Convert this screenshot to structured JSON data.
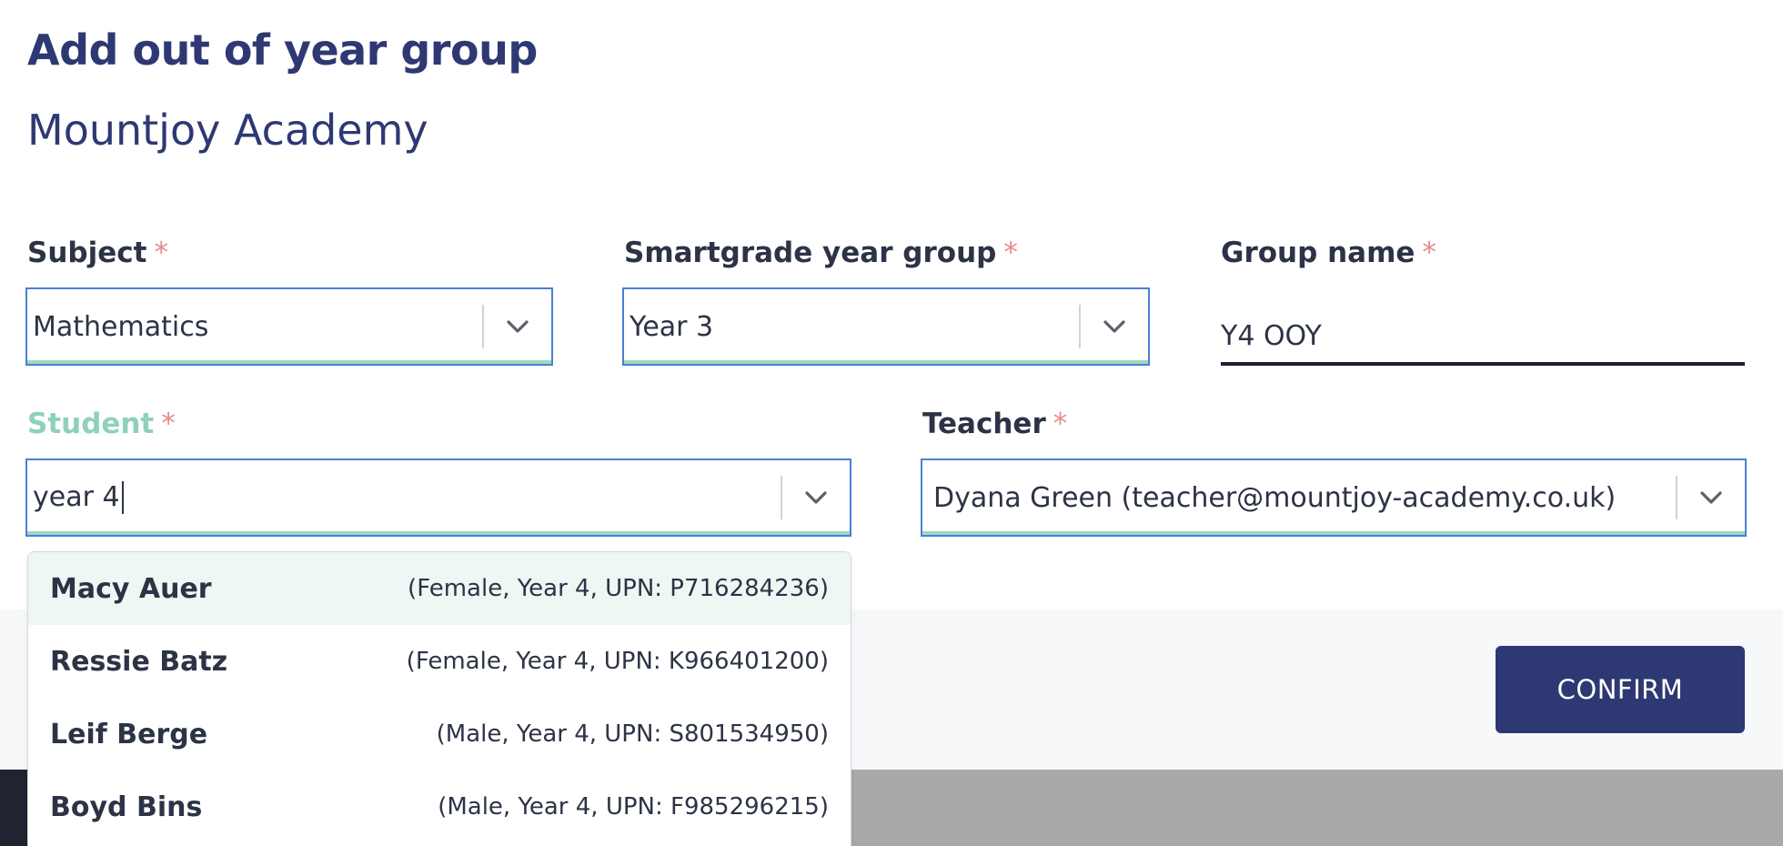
{
  "modal": {
    "title": "Add out of year group",
    "subtitle": "Mountjoy Academy"
  },
  "form": {
    "subject": {
      "label": "Subject",
      "required_mark": "*",
      "value": "Mathematics"
    },
    "year_group": {
      "label": "Smartgrade year group",
      "required_mark": "*",
      "value": "Year 3"
    },
    "group_name": {
      "label": "Group name",
      "required_mark": "*",
      "value": "Y4 OOY"
    },
    "student": {
      "label": "Student",
      "required_mark": "*",
      "search_text": "year 4"
    },
    "teacher": {
      "label": "Teacher",
      "required_mark": "*",
      "value": "Dyana Green (teacher@mountjoy-academy.co.uk)"
    }
  },
  "student_options": [
    {
      "name": "Macy Auer",
      "meta": "(Female, Year 4, UPN: P716284236)"
    },
    {
      "name": "Ressie Batz",
      "meta": "(Female, Year 4, UPN: K966401200)"
    },
    {
      "name": "Leif Berge",
      "meta": "(Male, Year 4, UPN: S801534950)"
    },
    {
      "name": "Boyd Bins",
      "meta": "(Male, Year 4, UPN: F985296215)"
    }
  ],
  "actions": {
    "confirm_label": "CONFIRM"
  },
  "icons": {
    "dropdown": "chevron-down-icon"
  },
  "colors": {
    "primary": "#2e3873",
    "focus_border": "#4a7fd6",
    "accent_green": "#9fd9c2",
    "required": "#e88a8a"
  }
}
